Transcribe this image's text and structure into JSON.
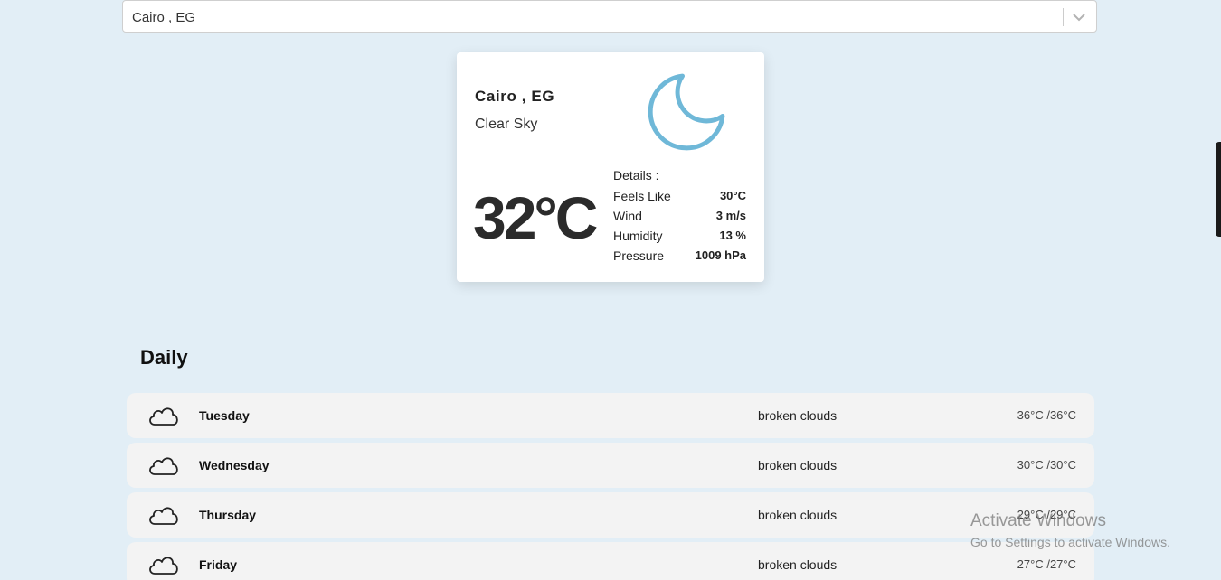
{
  "search": {
    "value": "Cairo , EG"
  },
  "current": {
    "location": "Cairo , EG",
    "description": "Clear Sky",
    "temperature": "32°C",
    "icon": "moon-icon",
    "details_title": "Details :",
    "details": [
      {
        "label": "Feels Like",
        "value": "30°C"
      },
      {
        "label": "Wind",
        "value": "3 m/s"
      },
      {
        "label": "Humidity",
        "value": "13 %"
      },
      {
        "label": "Pressure",
        "value": "1009 hPa"
      }
    ]
  },
  "daily": {
    "heading": "Daily",
    "days": [
      {
        "name": "Tuesday",
        "description": "broken clouds",
        "temps": "36°C /36°C",
        "icon": "cloud-icon"
      },
      {
        "name": "Wednesday",
        "description": "broken clouds",
        "temps": "30°C /30°C",
        "icon": "cloud-icon"
      },
      {
        "name": "Thursday",
        "description": "broken clouds",
        "temps": "29°C /29°C",
        "icon": "cloud-icon"
      },
      {
        "name": "Friday",
        "description": "broken clouds",
        "temps": "27°C /27°C",
        "icon": "cloud-icon"
      }
    ]
  },
  "watermark": {
    "title": "Activate Windows",
    "subtitle": "Go to Settings to activate Windows."
  },
  "colors": {
    "background": "#e2eef6",
    "moon": "#6fb8d8",
    "row": "#f3f3f3"
  }
}
